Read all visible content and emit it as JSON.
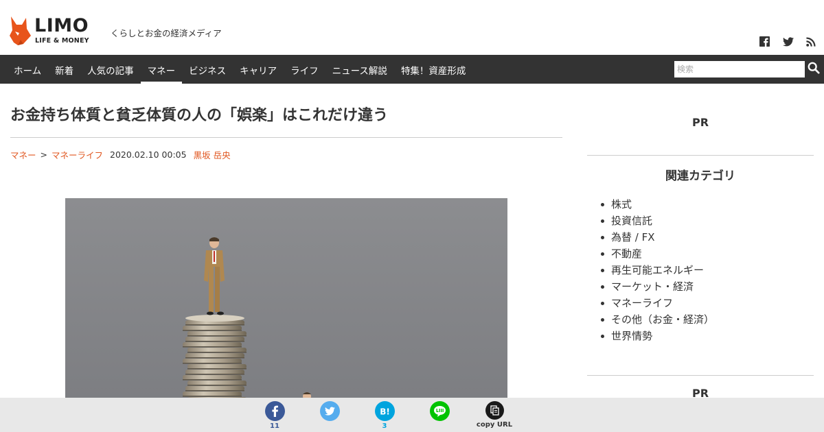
{
  "header": {
    "logo_word": "LIMO",
    "logo_sub": "LIFE & MONEY",
    "tagline": "くらしとお金の経済メディア",
    "social_icons": [
      "facebook-icon",
      "twitter-icon",
      "rss-icon"
    ]
  },
  "nav": {
    "items": [
      {
        "label": "ホーム",
        "active": false
      },
      {
        "label": "新着",
        "active": false
      },
      {
        "label": "人気の記事",
        "active": false
      },
      {
        "label": "マネー",
        "active": true
      },
      {
        "label": "ビジネス",
        "active": false
      },
      {
        "label": "キャリア",
        "active": false
      },
      {
        "label": "ライフ",
        "active": false
      },
      {
        "label": "ニュース解説",
        "active": false
      },
      {
        "label": "特集！資産形成",
        "active": false
      }
    ],
    "search_placeholder": "検索"
  },
  "article": {
    "title": "お金持ち体質と貧乏体質の人の「娯楽」はこれだけ違う",
    "category": "マネー",
    "breadcrumb_sep": ">",
    "subcategory": "マネーライフ",
    "date": "2020.02.10 00:05",
    "author": "黒坂 岳央"
  },
  "sidebar": {
    "pr_top": "PR",
    "heading": "関連カテゴリ",
    "categories": [
      "株式",
      "投資信託",
      "為替 / FX",
      "不動産",
      "再生可能エネルギー",
      "マーケット・経済",
      "マネーライフ",
      "その他（お金・経済）",
      "世界情勢"
    ],
    "pr_bottom": "PR"
  },
  "share": {
    "facebook_count": "11",
    "twitter_count": "",
    "hatena_count": "3",
    "line_count": "",
    "copy_label": "copy URL"
  },
  "colors": {
    "accent": "#e0551e",
    "nav_bg": "#333333",
    "facebook": "#3b5998",
    "twitter": "#55acee",
    "hatena": "#00a4de",
    "line": "#00c300"
  }
}
